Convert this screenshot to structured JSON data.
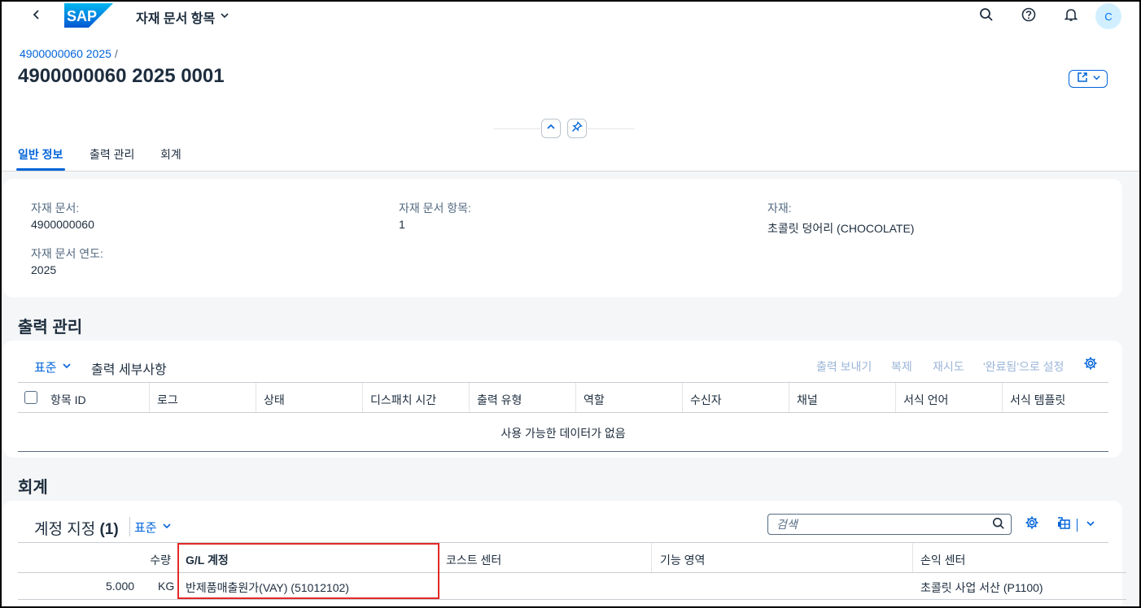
{
  "shell": {
    "logo_text": "SAP",
    "app_title": "자재 문서 항목",
    "avatar_initial": "C"
  },
  "header": {
    "breadcrumb_link": "4900000060 2025",
    "breadcrumb_sep": "/",
    "title": "4900000060 2025 0001"
  },
  "tabs": [
    {
      "label": "일반 정보",
      "active": true
    },
    {
      "label": "출력 관리",
      "active": false
    },
    {
      "label": "회계",
      "active": false
    }
  ],
  "general": {
    "fields": [
      {
        "label": "자재 문서:",
        "value": "4900000060"
      },
      {
        "label": "자재 문서 항목:",
        "value": "1"
      },
      {
        "label": "자재:",
        "value": "초콜릿 덩어리 (CHOCOLATE)"
      },
      {
        "label": "자재 문서 연도:",
        "value": "2025"
      }
    ]
  },
  "output": {
    "section_title": "출력 관리",
    "variant": "표준",
    "toolbar_title": "출력 세부사항",
    "actions": [
      "출력 보내기",
      "복제",
      "재시도",
      "'완료됨'으로 설정"
    ],
    "columns": [
      "항목 ID",
      "로그",
      "상태",
      "디스패치 시간",
      "출력 유형",
      "역할",
      "수신자",
      "채널",
      "서식 언어",
      "서식 템플릿"
    ],
    "no_data": "사용 가능한 데이터가 없음"
  },
  "accounting": {
    "section_title": "회계",
    "table_title": "계정 지정",
    "count": "(1)",
    "variant": "표준",
    "search_placeholder": "검색",
    "columns": [
      "수량",
      "G/L 계정",
      "코스트 센터",
      "기능 영역",
      "손익 센터"
    ],
    "rows": [
      {
        "quantity": "5.000",
        "unit": "KG",
        "gl_account": "반제품매출원가(VAY) (51012102)",
        "cost_center": "",
        "functional_area": "",
        "profit_center": "초콜릿 사업 서산 (P1100)"
      }
    ]
  },
  "colors": {
    "accent": "#0064d9",
    "highlight": "#e32926"
  }
}
